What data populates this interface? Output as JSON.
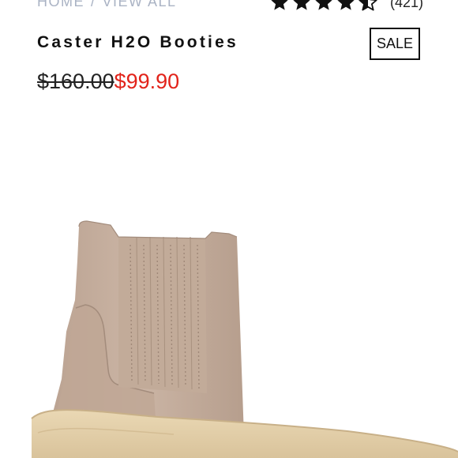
{
  "breadcrumb": {
    "items": [
      "HOME",
      "VIEW ALL"
    ],
    "separator": "/"
  },
  "rating": {
    "value": 4.5,
    "max": 5,
    "count_text": "(421)"
  },
  "product": {
    "name": "Caster H2O Booties",
    "badge": "SALE",
    "price_original": "$160.00",
    "price_sale": "$99.90",
    "image_icon": "ankle-boot-image"
  },
  "colors": {
    "sale_price": "#e2231a",
    "breadcrumb": "#aab3c4",
    "boot_suede": "#c7b09f",
    "sole": "#e2cfa9"
  }
}
